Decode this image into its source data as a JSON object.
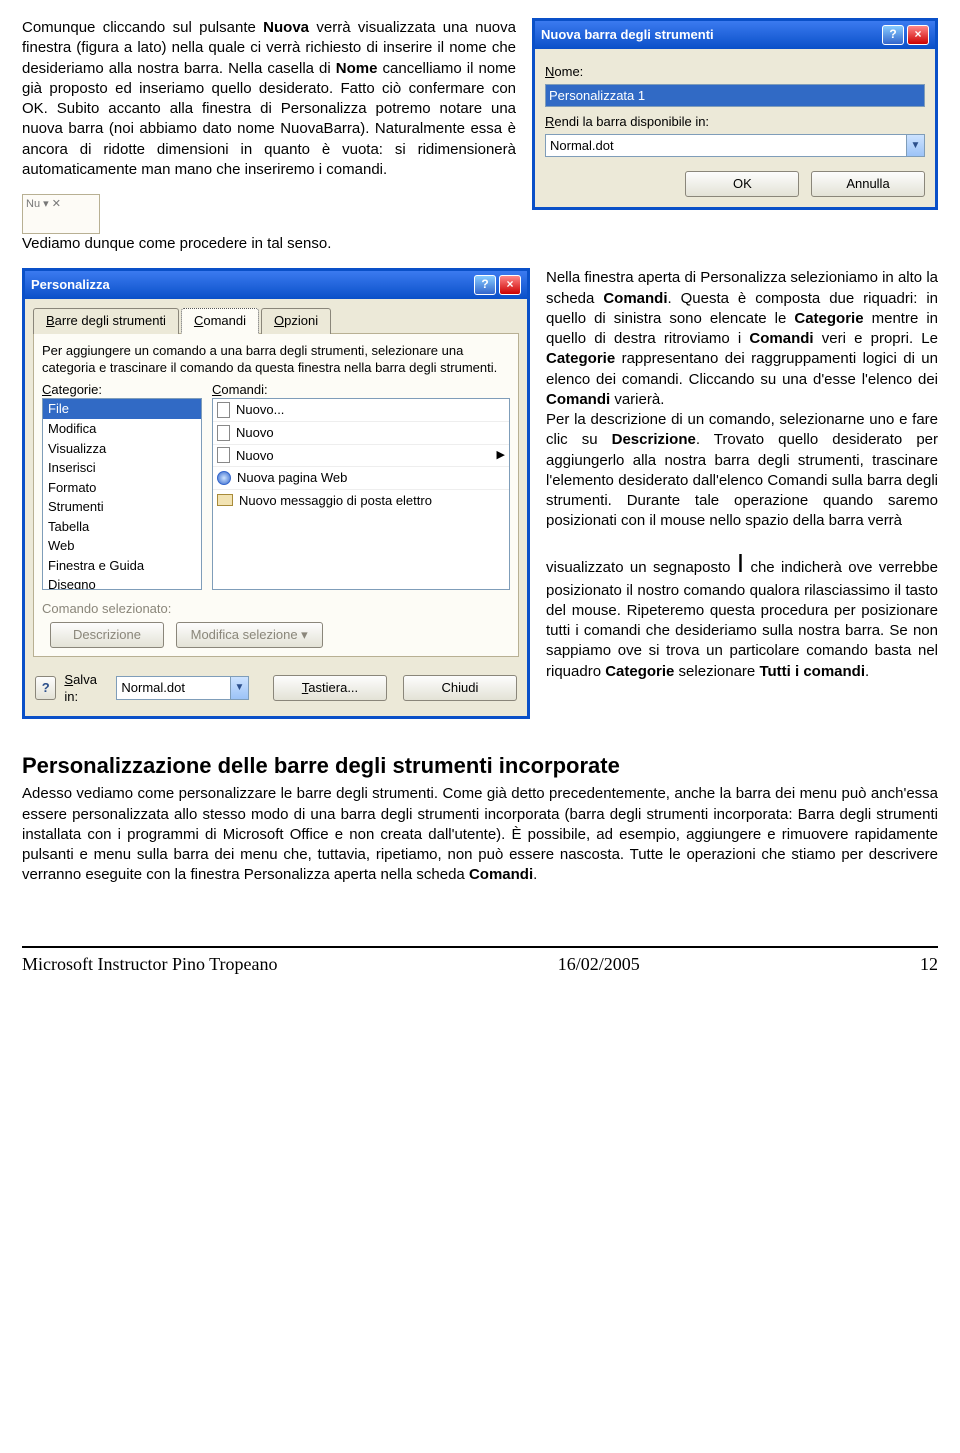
{
  "para1_a": "Comunque cliccando sul pulsante ",
  "para1_b": "Nuova",
  "para1_c": " verrà visualizzata una nuova finestra (figura a lato) nella quale ci verrà richiesto di inserire il nome che desideriamo alla nostra barra. Nella casella di ",
  "para1_d": "Nome",
  "para1_e": " cancelliamo il nome già proposto ed inseriamo quello desiderato. Fatto ciò confermare con OK. Subito accanto alla finestra di Personalizza potremo notare una nuova barra (noi abbiamo dato nome NuovaBarra). Naturalmente essa è ancora di ridotte dimensioni in quanto è vuota: si ridimensionerà automaticamente man mano che inseriremo i comandi.",
  "para2": "Vediamo dunque come procedere in tal senso.",
  "tiny_toolbar": {
    "header": "Nu ▾  ✕"
  },
  "dlg1": {
    "title": "Nuova barra degli strumenti",
    "name_label": "Nome:",
    "name_value": "Personalizzata 1",
    "avail_label": "Rendi la barra disponibile in:",
    "avail_value": "Normal.dot",
    "ok": "OK",
    "cancel": "Annulla"
  },
  "dlg2": {
    "title": "Personalizza",
    "tabs": {
      "t1": "Barre degli strumenti",
      "t2": "Comandi",
      "t3": "Opzioni"
    },
    "instr": "Per aggiungere un comando a una barra degli strumenti, selezionare una categoria e trascinare il comando da questa finestra nella barra degli strumenti.",
    "cat_label": "Categorie:",
    "cmd_label": "Comandi:",
    "categories": [
      "File",
      "Modifica",
      "Visualizza",
      "Inserisci",
      "Formato",
      "Strumenti",
      "Tabella",
      "Web",
      "Finestra e Guida",
      "Disegno"
    ],
    "commands": [
      {
        "label": "Nuovo...",
        "icon": "page",
        "expand": false
      },
      {
        "label": "Nuovo",
        "icon": "page",
        "expand": false
      },
      {
        "label": "Nuovo",
        "icon": "page",
        "expand": true
      },
      {
        "label": "Nuova pagina Web",
        "icon": "web",
        "expand": false
      },
      {
        "label": "Nuovo messaggio di posta elettro",
        "icon": "env",
        "expand": false
      }
    ],
    "selcmd_label": "Comando selezionato:",
    "descr_btn": "Descrizione",
    "modsel_btn": "Modifica selezione  ▾",
    "save_in_label": "Salva in:",
    "save_in_value": "Normal.dot",
    "keyboard_btn": "Tastiera...",
    "close_btn": "Chiudi"
  },
  "para3_a": "Nella finestra aperta di Personalizza selezioniamo in alto la scheda ",
  "para3_b": "Comandi",
  "para3_c": ". Questa è composta due riquadri: in quello di sinistra sono elencate le ",
  "para3_d": "Categorie",
  "para3_e": " mentre in quello di destra ritroviamo i ",
  "para3_f": "Comandi",
  "para3_g": " veri e propri. Le ",
  "para3_h": "Categorie",
  "para3_i": " rappresentano dei raggruppamenti logici di un elenco dei comandi. Cliccando su una d'esse l'elenco dei ",
  "para3_j": "Comandi",
  "para3_k": " varierà.",
  "para3_l1": "Per la descrizione di un comando, selezionarne uno e fare clic su ",
  "para3_l2": "Descrizione",
  "para3_l3": ". Trovato quello desiderato per aggiungerlo alla nostra barra degli strumenti, trascinare l'elemento desiderato dall'elenco Comandi sulla barra degli strumenti. Durante tale operazione quando saremo posizionati con il mouse nello spazio della barra verrà",
  "para3m_a": "visualizzato un segnaposto ",
  "para3m_b": "I",
  "para3m_c": " che indicherà ove verrebbe posizionato il nostro comando qualora rilasciassimo il tasto del mouse. Ripeteremo questa procedura per posizionare tutti i comandi che desideriamo sulla nostra barra. Se non sappiamo ove si trova un particolare comando basta nel riquadro ",
  "para3m_d": "Categorie",
  "para3m_e": " selezionare ",
  "para3m_f": "Tutti i comandi",
  "para3m_g": ".",
  "section_title": "Personalizzazione delle barre degli strumenti incorporate",
  "para4_a": "Adesso vediamo come personalizzare le barre degli strumenti. Come già detto precedentemente, anche la barra dei menu può anch'essa essere personalizzata allo stesso modo di una barra degli strumenti incorporata (barra degli strumenti incorporata: Barra degli strumenti installata con i programmi di Microsoft Office e non creata dall'utente). È possibile, ad esempio, aggiungere e rimuovere rapidamente pulsanti e menu sulla barra dei menu che, tuttavia, ripetiamo, non può essere nascosta.  Tutte le operazioni che stiamo per descrivere verranno eseguite con la finestra Personalizza aperta nella scheda ",
  "para4_b": "Comandi",
  "para4_c": ".",
  "footer": {
    "left": "Microsoft Instructor Pino Tropeano",
    "center": "16/02/2005",
    "right": "12"
  }
}
